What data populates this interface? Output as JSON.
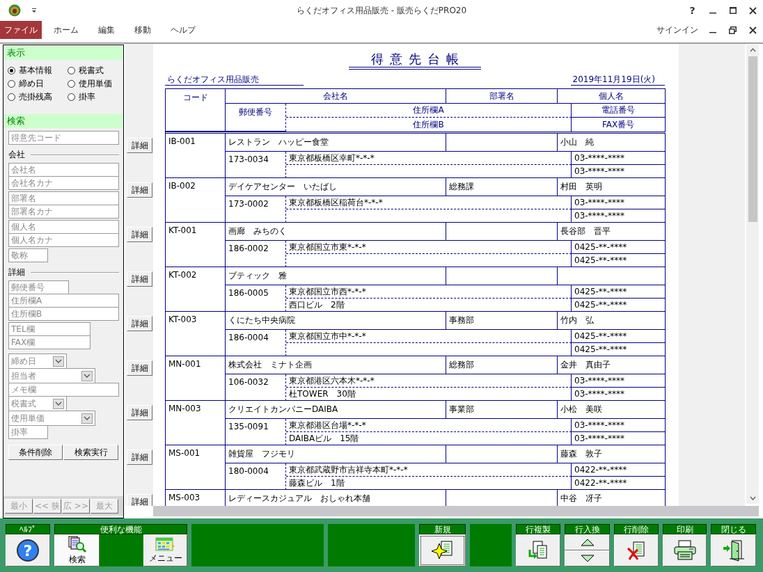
{
  "window": {
    "title": "らくだオフィス用品販売 - 販売らくだPRO20",
    "help": "?"
  },
  "menu": {
    "items": [
      {
        "label": "ファイル",
        "selected": true
      },
      {
        "label": "ホーム",
        "selected": false
      },
      {
        "label": "編集",
        "selected": false
      },
      {
        "label": "移動",
        "selected": false
      },
      {
        "label": "ヘルプ",
        "selected": false
      }
    ],
    "signin": "サインイン"
  },
  "display_panel": {
    "title": "表示",
    "options": [
      {
        "label": "基本情報",
        "selected": true
      },
      {
        "label": "税書式",
        "selected": false
      },
      {
        "label": "締め日",
        "selected": false
      },
      {
        "label": "使用単価",
        "selected": false
      },
      {
        "label": "売掛残高",
        "selected": false
      },
      {
        "label": "掛率",
        "selected": false
      }
    ]
  },
  "search_panel": {
    "title": "検索",
    "items": [
      {
        "kind": "stack",
        "fields": [
          {
            "kind": "text",
            "placeholder": "得意先コード"
          }
        ]
      },
      {
        "kind": "heading",
        "label": "会社"
      },
      {
        "kind": "stack",
        "fields": [
          {
            "kind": "text",
            "placeholder": "会社名"
          },
          {
            "kind": "text",
            "placeholder": "会社名カナ"
          }
        ]
      },
      {
        "kind": "stack",
        "fields": [
          {
            "kind": "text",
            "placeholder": "部署名"
          },
          {
            "kind": "text",
            "placeholder": "部署名カナ"
          }
        ]
      },
      {
        "kind": "stack",
        "fields": [
          {
            "kind": "text",
            "placeholder": "個人名"
          },
          {
            "kind": "text",
            "placeholder": "個人名カナ"
          }
        ]
      },
      {
        "kind": "stack",
        "fields": [
          {
            "kind": "text",
            "placeholder": "敬称"
          }
        ]
      },
      {
        "kind": "heading",
        "label": "詳細"
      },
      {
        "kind": "stack",
        "fields": [
          {
            "kind": "text",
            "placeholder": "郵便番号"
          },
          {
            "kind": "text",
            "placeholder": "住所欄A"
          },
          {
            "kind": "text",
            "placeholder": "住所欄B"
          }
        ]
      },
      {
        "kind": "stack",
        "fields": [
          {
            "kind": "text",
            "placeholder": "TEL欄"
          },
          {
            "kind": "text",
            "placeholder": "FAX欄"
          }
        ]
      },
      {
        "kind": "stack",
        "fields": [
          {
            "kind": "select",
            "placeholder": "締め日"
          },
          {
            "kind": "select",
            "placeholder": "担当者"
          },
          {
            "kind": "text",
            "placeholder": "メモ欄"
          },
          {
            "kind": "select",
            "placeholder": "税書式"
          },
          {
            "kind": "select",
            "placeholder": "使用単価"
          },
          {
            "kind": "text",
            "placeholder": "掛率"
          }
        ]
      }
    ],
    "buttons": [
      "条件削除",
      "検索実行"
    ],
    "zoom_buttons": [
      {
        "label": "最小",
        "disabled": true
      },
      {
        "label": "<< 狭",
        "disabled": true
      },
      {
        "label": "広 >>",
        "disabled": true
      },
      {
        "label": "最大",
        "disabled": true
      }
    ]
  },
  "ledger": {
    "title": "得意先台帳",
    "company": "らくだオフィス用品販売",
    "date": "2019年11月19日(火)",
    "header": {
      "code": "コード",
      "company": "会社名",
      "department": "部署名",
      "person": "個人名",
      "zip": "郵便番号",
      "address_a": "住所欄A",
      "address_b": "住所欄B",
      "phone": "電話番号",
      "fax": "FAX番号"
    },
    "records": [
      {
        "button": "詳細",
        "code": "IB-001",
        "company": "レストラン　ハッピー食堂",
        "person": "小山　純",
        "zip": "173-0034",
        "address_a": "東京都板橋区幸町*-*-*",
        "phone": "03-****-****",
        "fax": "03-****-****"
      },
      {
        "button": "詳細",
        "code": "IB-002",
        "company": "デイケアセンター　いたばし",
        "department": "総務課",
        "person": "村田　英明",
        "zip": "173-0002",
        "address_a": "東京都板橋区稲荷台*-*-*",
        "phone": "03-****-****",
        "fax": "03-****-****"
      },
      {
        "button": "詳細",
        "code": "KT-001",
        "company": "画廊　みちのく",
        "person": "長谷部　晋平",
        "zip": "186-0002",
        "address_a": "東京都国立市東*-*-*",
        "phone": "0425-**-****",
        "fax": "0425-**-****"
      },
      {
        "button": "詳細",
        "code": "KT-002",
        "company": "ブティック　雅",
        "zip": "186-0005",
        "address_a": "東京都国立市西*-*-*",
        "address_b": "西口ビル　2階",
        "phone": "0425-**-****",
        "fax": "0425-**-****"
      },
      {
        "button": "詳細",
        "code": "KT-003",
        "company": "くにたち中央病院",
        "department": "事務部",
        "person": "竹内　弘",
        "zip": "186-0004",
        "address_a": "東京都国立市中*-*-*",
        "phone": "0425-**-****",
        "fax": "0425-**-****"
      },
      {
        "button": "詳細",
        "code": "MN-001",
        "company": "株式会社　ミナト企画",
        "department": "総務部",
        "person": "金井　真由子",
        "zip": "106-0032",
        "address_a": "東京都港区六本木*-*-*",
        "address_b": "杜TOWER　30階",
        "phone": "03-****-****",
        "fax": "03-****-****"
      },
      {
        "button": "詳細",
        "code": "MN-003",
        "company": "クリエイトカンパニーDAIBA",
        "department": "事業部",
        "person": "小松　美咲",
        "zip": "135-0091",
        "address_a": "東京都港区台場*-*-*",
        "address_b": "DAIBAビル　15階",
        "phone": "03-****-****",
        "fax": "03-****-****"
      },
      {
        "button": "詳細",
        "code": "MS-001",
        "company": "雑貨屋　フジモリ",
        "person": "藤森　敦子",
        "zip": "180-0004",
        "address_a": "東京都武蔵野市吉祥寺本町*-*-*",
        "address_b": "藤森ビル　1階",
        "phone": "0422-**-****",
        "fax": "0422-**-****"
      },
      {
        "button": "詳細",
        "code": "MS-003",
        "company": "レディースカジュアル　おしゃれ本舗",
        "person": "中谷　冴子"
      }
    ]
  },
  "toolbar": [
    {
      "kind": "help",
      "label": "ﾍﾙﾌﾟ",
      "buttons": [
        {
          "glyph": "?",
          "focused": false
        }
      ]
    },
    {
      "kind": "tools",
      "label": "便利な機能",
      "buttons": [
        {
          "label": "検索",
          "focused": false
        },
        {
          "label": "メニュー",
          "focused": false
        }
      ]
    },
    {
      "kind": "blank"
    },
    {
      "kind": "blank"
    },
    {
      "kind": "new",
      "label": "新規",
      "buttons": [
        {
          "focused": true
        }
      ]
    },
    {
      "kind": "blank"
    },
    {
      "kind": "copy",
      "label": "行複製",
      "buttons": [
        {
          "focused": false
        }
      ]
    },
    {
      "kind": "swap",
      "label": "行入換",
      "buttons": [
        {
          "focused": false
        },
        {
          "focused": false
        }
      ]
    },
    {
      "kind": "delete",
      "label": "行削除",
      "buttons": [
        {
          "focused": false
        }
      ]
    },
    {
      "kind": "print",
      "label": "印刷",
      "buttons": [
        {
          "focused": false
        }
      ]
    },
    {
      "kind": "close",
      "label": "閉じる",
      "buttons": [
        {
          "focused": false
        }
      ]
    }
  ]
}
